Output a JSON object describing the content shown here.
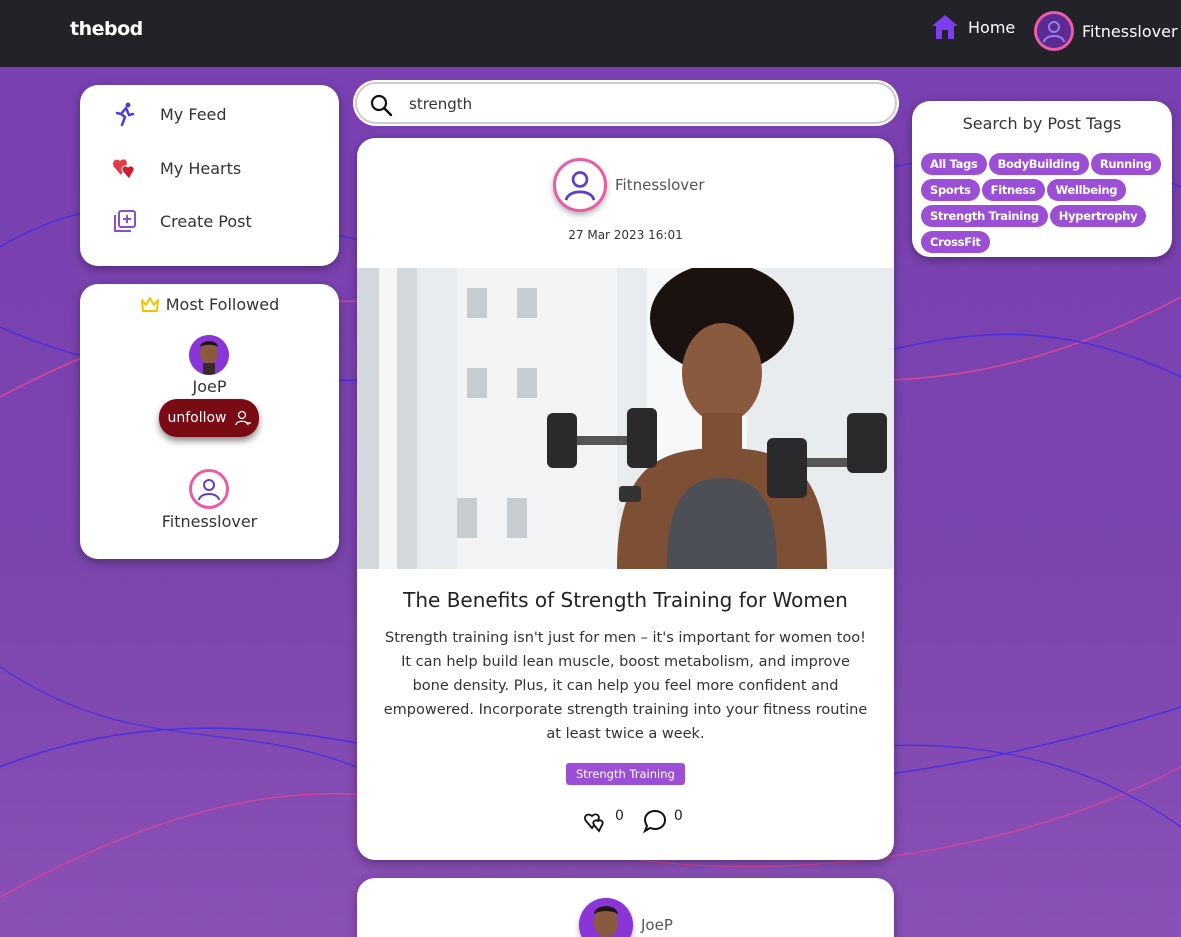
{
  "nav": {
    "brand": "thebod",
    "home_label": "Home",
    "profile_label": "Fitnesslover"
  },
  "menu": {
    "items": [
      {
        "label": "My Feed",
        "icon": "runner-icon"
      },
      {
        "label": "My Hearts",
        "icon": "hearts-icon"
      },
      {
        "label": "Create Post",
        "icon": "add-post-icon"
      }
    ]
  },
  "most_followed": {
    "title": "Most Followed",
    "users": [
      {
        "name": "JoeP",
        "button": "unfollow"
      },
      {
        "name": "Fitnesslover"
      }
    ]
  },
  "search": {
    "value": "strength",
    "placeholder": ""
  },
  "post": {
    "author": "Fitnesslover",
    "date": "27 Mar 2023 16:01",
    "title": "The Benefits of Strength Training for Women",
    "body": "Strength training isn't just for men – it's important for women too! It can help build lean muscle, boost metabolism, and improve bone density. Plus, it can help you feel more confident and empowered. Incorporate strength training into your fitness routine at least twice a week.",
    "tag": "Strength Training",
    "hearts": "0",
    "comments": "0"
  },
  "post2": {
    "author": "JoeP"
  },
  "tags_panel": {
    "title": "Search by Post Tags",
    "tags": [
      "All Tags",
      "BodyBuilding",
      "Running",
      "Sports",
      "Fitness",
      "Wellbeing",
      "Strength Training",
      "Hypertrophy",
      "CrossFit"
    ]
  },
  "colors": {
    "accent": "#9b4fd4",
    "topbar": "#232228",
    "unfollow": "#7a0b14",
    "avatar_ring": "#e95ca8"
  }
}
